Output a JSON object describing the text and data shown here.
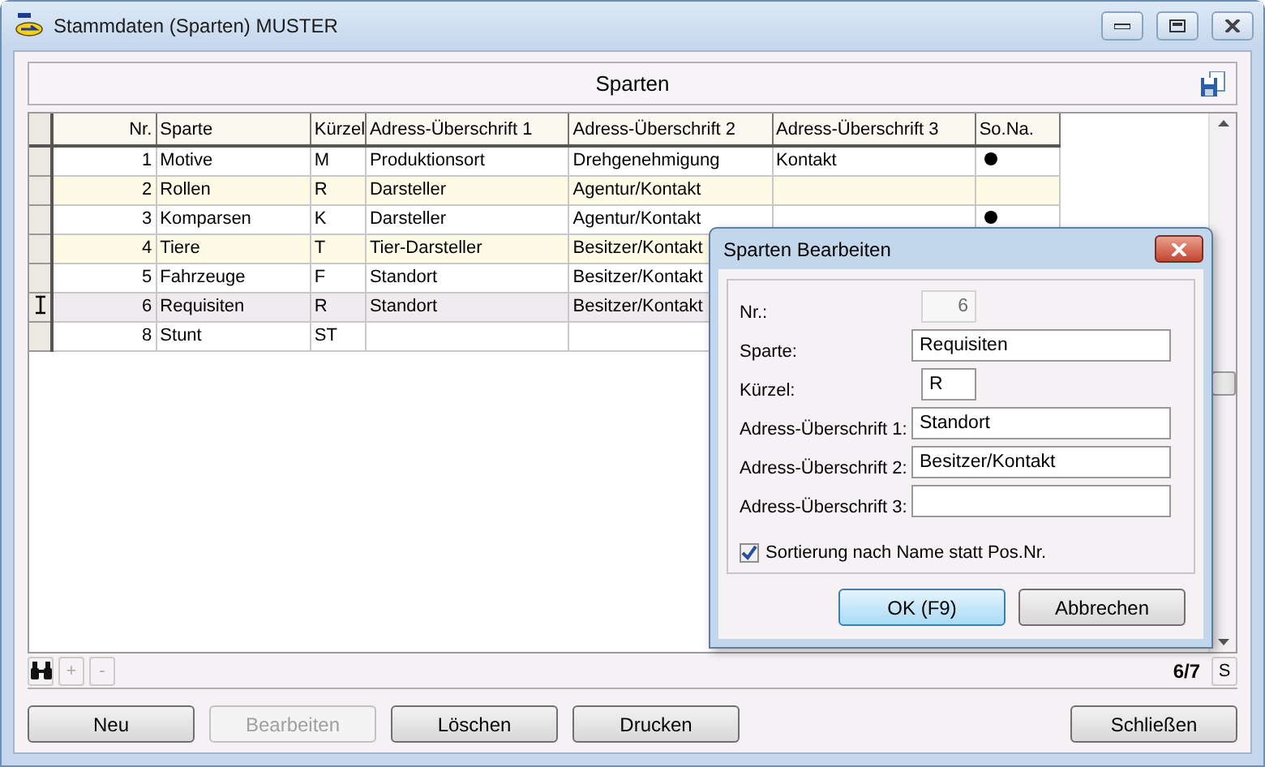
{
  "window": {
    "title": "Stammdaten (Sparten) MUSTER"
  },
  "panel": {
    "title": "Sparten"
  },
  "table": {
    "columns": [
      "Nr.",
      "Sparte",
      "Kürzel",
      "Adress-Überschrift 1",
      "Adress-Überschrift 2",
      "Adress-Überschrift 3",
      "So.Na."
    ],
    "rows": [
      {
        "cells": [
          "1",
          "Motive",
          "M",
          "Produktionsort",
          "Drehgenehmigung",
          "Kontakt"
        ],
        "sona": true,
        "selected": false
      },
      {
        "cells": [
          "2",
          "Rollen",
          "R",
          "Darsteller",
          "Agentur/Kontakt"
        ],
        "sona": false,
        "selected": false
      },
      {
        "cells": [
          "3",
          "Komparsen",
          "K",
          "Darsteller",
          "Agentur/Kontakt"
        ],
        "sona": true,
        "selected": false
      },
      {
        "cells": [
          "4",
          "Tiere",
          "T",
          "Tier-Darsteller",
          "Besitzer/Kontakt"
        ],
        "selected": false
      },
      {
        "cells": [
          "5",
          "Fahrzeuge",
          "F",
          "Standort",
          "Besitzer/Kontakt"
        ],
        "selected": false
      },
      {
        "cells": [
          "6",
          "Requisiten",
          "R",
          "Standort",
          "Besitzer/Kontakt"
        ],
        "selected": true
      },
      {
        "cells": [
          "8",
          "Stunt",
          "ST"
        ],
        "selected": false
      }
    ]
  },
  "navigator": {
    "add": "+",
    "remove": "-",
    "counter": "6/7",
    "search": "S"
  },
  "buttons": [
    {
      "label": "Neu",
      "disabled": false
    },
    {
      "label": "Bearbeiten",
      "disabled": true
    },
    {
      "label": "Löschen",
      "disabled": false
    },
    {
      "label": "Drucken",
      "disabled": false
    }
  ],
  "close_button": {
    "label": "Schließen"
  },
  "dialog": {
    "title": "Sparten Bearbeiten",
    "fields": [
      {
        "label": "Nr.:",
        "value": "6",
        "kind": "short",
        "disabled": true
      },
      {
        "label": "Sparte:",
        "value": "Requisiten",
        "kind": "long",
        "disabled": false
      },
      {
        "label": "Kürzel:",
        "value": "R",
        "kind": "short",
        "disabled": false
      },
      {
        "label": "Adress-Überschrift 1:",
        "value": "Standort",
        "kind": "long",
        "disabled": false
      },
      {
        "label": "Adress-Überschrift 2:",
        "value": "Besitzer/Kontakt",
        "kind": "long",
        "disabled": false
      },
      {
        "label": "Adress-Überschrift 3:",
        "kind": "long",
        "disabled": false
      }
    ],
    "checkbox": {
      "label": "Sortierung nach Name statt Pos.Nr.",
      "checked": true
    },
    "buttons": [
      {
        "label": "OK (F9)",
        "default": true
      },
      {
        "label": "Abbrechen",
        "default": false
      }
    ]
  }
}
